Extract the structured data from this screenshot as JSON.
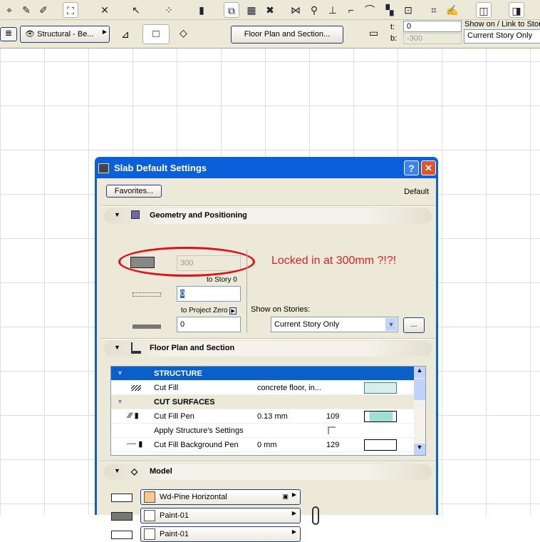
{
  "toolbar_top": {
    "icons": [
      "magic-wand-icon",
      "eyedropper-icon",
      "syringe-icon",
      "snap-guide-icon",
      "trim-icon",
      "pointer-icon",
      "grid-icon",
      "pen-icon",
      "layer-stack-icon",
      "ruler-icon",
      "cross-icon",
      "split-icon",
      "adjust-icon",
      "elevation-icon",
      "fillet-icon",
      "curve-icon",
      "offset-icon",
      "resize-icon",
      "rotate-icon",
      "marker-icon",
      "view-icon",
      "3d-icon"
    ]
  },
  "info_box": {
    "layer": "Structural - Be...",
    "floor_plan_button": "Floor Plan and Section...",
    "top_label": "t:",
    "top_value": "0",
    "bottom_label": "b:",
    "bottom_value": "-300",
    "show_on_label": "Show on / Link to Stor",
    "show_on_value": "Current Story Only"
  },
  "dialog": {
    "title": "Slab Default Settings",
    "help": "?",
    "close": "✕",
    "favorites": "Favorites...",
    "default_label": "Default",
    "geometry": {
      "title": "Geometry and Positioning",
      "thickness": "300",
      "to_story_label": "to Story 0",
      "to_story_value": "0",
      "to_project_zero_label": "to Project Zero",
      "to_project_zero_value": "0",
      "show_on_stories_label": "Show on Stories:",
      "show_on_stories_value": "Current Story Only",
      "more_button": "..."
    },
    "annotation": "Locked in at 300mm ?!?!",
    "floor_plan": {
      "title": "Floor Plan and Section",
      "rows": [
        {
          "type": "header",
          "label": "STRUCTURE",
          "selected": true
        },
        {
          "type": "item",
          "label": "Cut Fill",
          "value": "concrete floor, in...",
          "num": ""
        },
        {
          "type": "header",
          "label": "CUT SURFACES"
        },
        {
          "type": "item",
          "label": "Cut Fill Pen",
          "value": "0.13 mm",
          "num": "109"
        },
        {
          "type": "item",
          "label": "Apply Structure's Settings",
          "value": "",
          "num": ""
        },
        {
          "type": "item",
          "label": "Cut Fill Background Pen",
          "value": "0 mm",
          "num": "129"
        }
      ],
      "colors": {
        "selection": "#0a5fc9",
        "pen_109": "#9fe0d6"
      }
    },
    "model": {
      "title": "Model",
      "materials": [
        {
          "name": "Wd-Pine Horizontal",
          "color": "#f9c88a"
        },
        {
          "name": "Paint-01",
          "color": "#ffffff"
        },
        {
          "name": "Paint-01",
          "color": "#ffffff"
        }
      ]
    }
  }
}
